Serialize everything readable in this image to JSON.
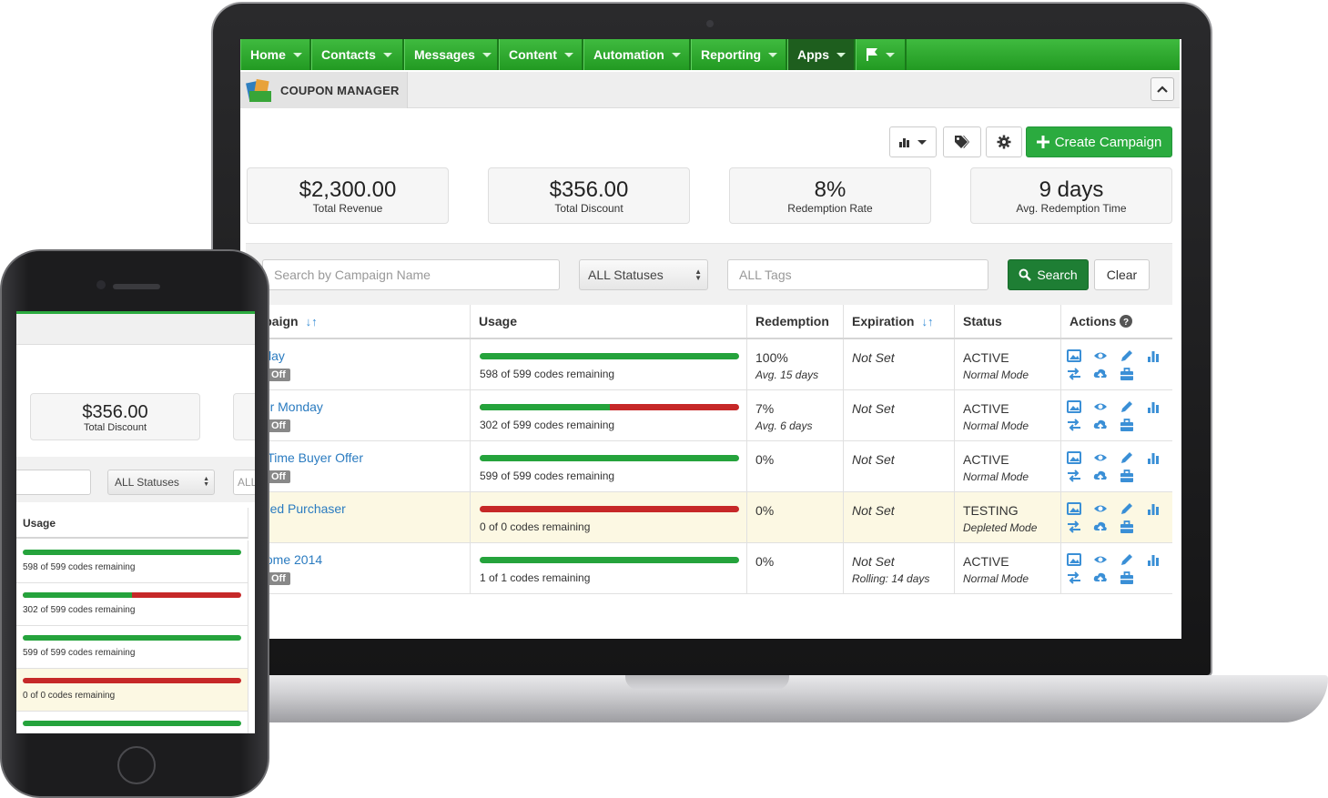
{
  "nav": {
    "items": [
      {
        "label": "Home"
      },
      {
        "label": "Contacts"
      },
      {
        "label": "Messages"
      },
      {
        "label": "Content"
      },
      {
        "label": "Automation"
      },
      {
        "label": "Reporting"
      },
      {
        "label": "Apps"
      }
    ]
  },
  "page": {
    "title": "COUPON MANAGER"
  },
  "toolbar": {
    "create_label": "Create Campaign"
  },
  "stats": [
    {
      "value": "$2,300.00",
      "label": "Total Revenue"
    },
    {
      "value": "$356.00",
      "label": "Total Discount"
    },
    {
      "value": "8%",
      "label": "Redemption Rate"
    },
    {
      "value": "9 days",
      "label": "Avg. Redemption Time"
    }
  ],
  "filter": {
    "search_placeholder": "Search by Campaign Name",
    "status_value": "ALL Statuses",
    "tags_placeholder": "ALL Tags",
    "search_label": "Search",
    "clear_label": "Clear"
  },
  "table": {
    "headers": {
      "campaign": "ampaign",
      "usage": "Usage",
      "redemption": "Redemption",
      "expiration": "Expiration",
      "status": "Status",
      "actions": "Actions"
    },
    "rows": [
      {
        "name": "rthday",
        "badge": "0% Off",
        "usage_fraction": 1.0,
        "usage_text": "598 of 599 codes remaining",
        "redemption": "100%",
        "redemption_avg": "Avg. 15 days",
        "expiration": "Not Set",
        "expiration_sub": "",
        "status": "ACTIVE",
        "mode": "Normal Mode"
      },
      {
        "name": "yber Monday",
        "badge": "0% Off",
        "usage_fraction": 0.5,
        "usage_text": "302 of 599 codes remaining",
        "redemption": "7%",
        "redemption_avg": "Avg. 6 days",
        "expiration": "Not Set",
        "expiration_sub": "",
        "status": "ACTIVE",
        "mode": "Normal Mode"
      },
      {
        "name": "rst Time Buyer Offer",
        "badge": "5% Off",
        "usage_fraction": 1.0,
        "usage_text": "599 of 599 codes remaining",
        "redemption": "0%",
        "redemption_avg": "",
        "expiration": "Not Set",
        "expiration_sub": "",
        "status": "ACTIVE",
        "mode": "Normal Mode"
      },
      {
        "name": "apsed Purchaser",
        "badge": "",
        "usage_fraction": 0.0,
        "usage_text": "0 of 0 codes remaining",
        "redemption": "0%",
        "redemption_avg": "",
        "expiration": "Not Set",
        "expiration_sub": "",
        "status": "TESTING",
        "mode": "Depleted Mode"
      },
      {
        "name": "elcome 2014",
        "badge": "0% Off",
        "usage_fraction": 1.0,
        "usage_text": "1 of 1 codes remaining",
        "redemption": "0%",
        "redemption_avg": "",
        "expiration": "Not Set",
        "expiration_sub": "Rolling: 14 days",
        "status": "ACTIVE",
        "mode": "Normal Mode"
      }
    ]
  },
  "phone": {
    "stat_value": "$356.00",
    "stat_label": "Total Discount",
    "status_value": "ALL Statuses",
    "tags_partial": "ALL",
    "usage_header": "Usage",
    "rows": [
      {
        "usage_fraction": 1.0,
        "usage_text": "598 of 599 codes remaining"
      },
      {
        "usage_fraction": 0.5,
        "usage_text": "302 of 599 codes remaining"
      },
      {
        "usage_fraction": 1.0,
        "usage_text": "599 of 599 codes remaining"
      },
      {
        "usage_fraction": 0.0,
        "usage_text": "0 of 0 codes remaining"
      },
      {
        "usage_fraction": 1.0,
        "usage_text": ""
      }
    ]
  },
  "colors": {
    "brand_green": "#2bab3f",
    "bar_green": "#25a33c",
    "bar_red": "#c62828",
    "link_blue": "#2a7bc0",
    "testing_row": "#fcf8e3"
  },
  "icons": [
    "bar-chart-icon",
    "tag-icon",
    "gear-icon",
    "plus-icon",
    "search-icon",
    "sort-icon",
    "help-icon",
    "image-icon",
    "eye-icon",
    "pencil-icon",
    "stats-icon",
    "swap-icon",
    "cloud-upload-icon",
    "briefcase-icon",
    "flag-icon",
    "chevron-up-icon"
  ]
}
